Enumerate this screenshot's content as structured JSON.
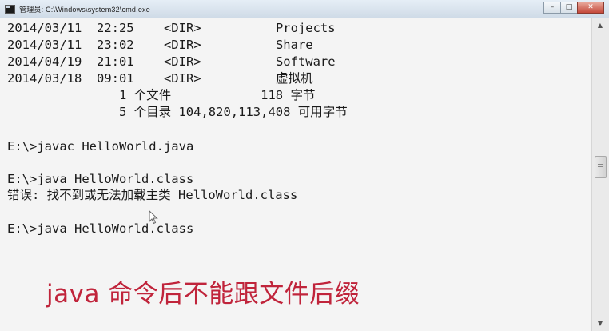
{
  "window": {
    "title": "管理员: C:\\Windows\\system32\\cmd.exe",
    "controls": {
      "minimize": "–",
      "maximize": "□",
      "close": "✕"
    }
  },
  "console": {
    "lines": [
      "2014/03/11  22:25    <DIR>          Projects",
      "2014/03/11  23:02    <DIR>          Share",
      "2014/04/19  21:01    <DIR>          Software",
      "2014/03/18  09:01    <DIR>          虚拟机",
      "               1 个文件            118 字节",
      "               5 个目录 104,820,113,408 可用字节",
      "",
      "E:\\>javac HelloWorld.java",
      "",
      "E:\\>java HelloWorld.class",
      "错误: 找不到或无法加载主类 HelloWorld.class",
      "",
      "E:\\>java HelloWorld.class"
    ]
  },
  "annotation": {
    "text": "java 命令后不能跟文件后缀",
    "color": "#c0243b"
  },
  "scrollbar": {
    "up_arrow": "▲",
    "down_arrow": "▼"
  }
}
